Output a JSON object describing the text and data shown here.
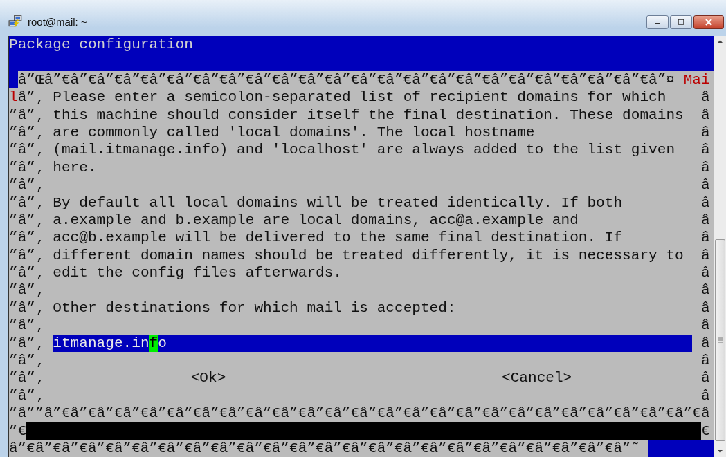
{
  "window": {
    "title": "root@mail: ~"
  },
  "terminal": {
    "lines": [
      {
        "kind": "title",
        "text": "Package configuration"
      },
      {
        "kind": "band"
      },
      {
        "kind": "top_border",
        "text": "â”Œâ”€â”€â”€â”€â”€â”€â”€â”€â”€â”€â”€â”€â”€â”€â”€â”€â”€â”€â”€â”€â”€â”€â”€â”¤",
        "alert": "Mai"
      },
      {
        "kind": "body",
        "alert": "l",
        "left": "â”‚",
        "text": "Please enter a semicolon-separated list of recipient domains for which",
        "right": "â"
      },
      {
        "kind": "body",
        "left": "”â”‚",
        "text": "this machine should consider itself the final destination. These domains",
        "right": "â"
      },
      {
        "kind": "body",
        "left": "”â”‚",
        "text": "are commonly called 'local domains'. The local hostname",
        "right": "â"
      },
      {
        "kind": "body",
        "left": "”â”‚",
        "text": "(mail.itmanage.info) and 'localhost' are always added to the list given",
        "right": "â"
      },
      {
        "kind": "body",
        "left": "”â”‚",
        "text": "here.",
        "right": "â"
      },
      {
        "kind": "body",
        "left": "”â”‚",
        "right": "â"
      },
      {
        "kind": "body",
        "left": "”â”‚",
        "text": "By default all local domains will be treated identically. If both",
        "right": "â"
      },
      {
        "kind": "body",
        "left": "”â”‚",
        "text": "a.example and b.example are local domains, acc@a.example and",
        "right": "â"
      },
      {
        "kind": "body",
        "left": "”â”‚",
        "text": "acc@b.example will be delivered to the same final destination. If",
        "right": "â"
      },
      {
        "kind": "body",
        "left": "”â”‚",
        "text": "different domain names should be treated differently, it is necessary to",
        "right": "â"
      },
      {
        "kind": "body",
        "left": "”â”‚",
        "text": "edit the config files afterwards.",
        "right": "â"
      },
      {
        "kind": "body",
        "left": "”â”‚",
        "right": "â"
      },
      {
        "kind": "body",
        "left": "”â”‚",
        "text": "Other destinations for which mail is accepted:",
        "right": "â"
      },
      {
        "kind": "body",
        "left": "”â”‚",
        "right": "â"
      },
      {
        "kind": "input",
        "left": "”â”‚",
        "before": "itmanage.in",
        "cursor": "f",
        "after": "o",
        "right": "â"
      },
      {
        "kind": "body",
        "left": "”â”‚",
        "right": "â"
      },
      {
        "kind": "buttons",
        "left": "”â”‚",
        "buttons": [
          {
            "label": "<Ok>",
            "selected": false
          },
          {
            "label": "<Cancel>",
            "selected": false
          }
        ],
        "right": "â"
      },
      {
        "kind": "body",
        "left": "”â”‚",
        "right": "â"
      },
      {
        "kind": "bottom_border",
        "text": "”â””â”€â”€â”€â”€â”€â”€â”€â”€â”€â”€â”€â”€â”€â”€â”€â”€â”€â”€â”€â”€â”€â”€â”€â”€â”€â"
      },
      {
        "kind": "shadow",
        "left": "”€",
        "right": "€"
      },
      {
        "kind": "last",
        "text": "â”€â”€â”€â”€â”€â”€â”€â”€â”€â”€â”€â”€â”€â”€â”€â”€â”€â”€â”€â”€â”€â”€â”€â”˜"
      }
    ]
  }
}
